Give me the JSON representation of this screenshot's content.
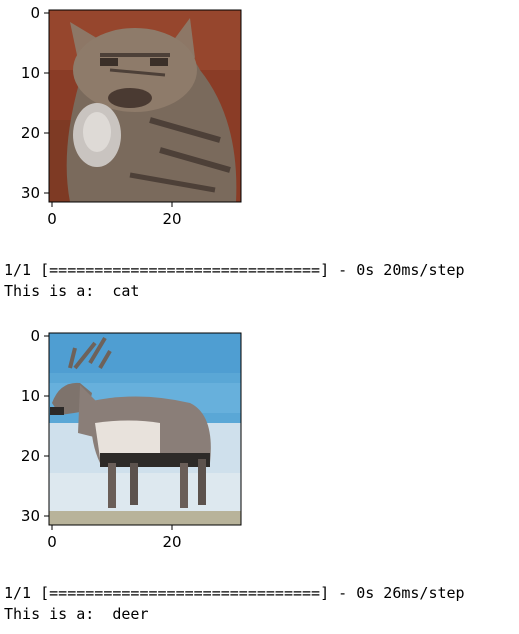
{
  "outputs": [
    {
      "image_subject": "cat",
      "y_ticks": [
        "0",
        "10",
        "20",
        "30"
      ],
      "x_ticks": [
        "0",
        "20"
      ],
      "progress_line": "1/1 [==============================] - 0s 20ms/step",
      "result_line": "This is a:  cat"
    },
    {
      "image_subject": "deer",
      "y_ticks": [
        "0",
        "10",
        "20",
        "30"
      ],
      "x_ticks": [
        "0",
        "20"
      ],
      "progress_line": "1/1 [==============================] - 0s 26ms/step",
      "result_line": "This is a:  deer"
    }
  ],
  "colors": {
    "cat_background": "#8a3c26",
    "cat_fur": "#7a6a5c",
    "cat_chest": "#c9c4c0",
    "deer_sky": "#5aa7d6",
    "deer_snow": "#cfe0ec",
    "deer_body": "#8a7e78",
    "deer_belly": "#e8e2dc",
    "deer_dark": "#2d2a28"
  }
}
